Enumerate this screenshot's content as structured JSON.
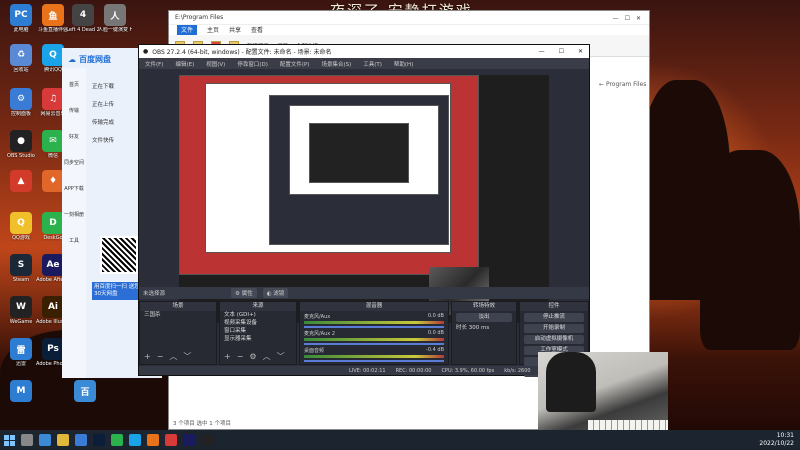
{
  "wallpaper": {
    "title": "夜深了 安静打游戏"
  },
  "desktop_icons": [
    {
      "label": "此电脑",
      "color": "#2d7dd2",
      "glyph": "PC"
    },
    {
      "label": "斗鱼直播伴侣",
      "color": "#e8731b",
      "glyph": "鱼"
    },
    {
      "label": "Left 4 Dead 2",
      "color": "#444",
      "glyph": "4"
    },
    {
      "label": "人脸一键演变 Human Fa...",
      "color": "#777",
      "glyph": "人"
    },
    {
      "label": "回收站",
      "color": "#5a8ad6",
      "glyph": "♻"
    },
    {
      "label": "腾讯QQ",
      "color": "#1aa3e8",
      "glyph": "Q"
    },
    {
      "label": "控制面板",
      "color": "#3a7bd5",
      "glyph": "⚙"
    },
    {
      "label": "网易云音乐",
      "color": "#d83a3a",
      "glyph": "♫"
    },
    {
      "label": "OBS Studio",
      "color": "#222",
      "glyph": "●"
    },
    {
      "label": "微信",
      "color": "#2bb24c",
      "glyph": "✉"
    },
    {
      "label": "",
      "color": "#d23a2a",
      "glyph": "▲"
    },
    {
      "label": "",
      "color": "#e0662a",
      "glyph": "♦"
    },
    {
      "label": "QQ游戏",
      "color": "#f0c02a",
      "glyph": "Q"
    },
    {
      "label": "DeskGo",
      "color": "#2bb24c",
      "glyph": "D"
    },
    {
      "label": "Steam",
      "color": "#1b2838",
      "glyph": "S"
    },
    {
      "label": "Adobe After...",
      "color": "#1a1a5e",
      "glyph": "Ae"
    },
    {
      "label": "WeGame",
      "color": "#222",
      "glyph": "W"
    },
    {
      "label": "Adobe Illustr...",
      "color": "#3a1f00",
      "glyph": "Ai"
    },
    {
      "label": "迅雷",
      "color": "#2d7dd2",
      "glyph": "雷"
    },
    {
      "label": "Adobe Photosh...",
      "color": "#0a1e3a",
      "glyph": "Ps"
    },
    {
      "label": "百度网盘",
      "color": "#3a8ad6",
      "glyph": "云"
    },
    {
      "label": "",
      "color": "#2d7dd2",
      "glyph": "M"
    },
    {
      "label": "",
      "color": "#3a8ad6",
      "glyph": "百"
    }
  ],
  "explorer": {
    "title": "E:\\Program Files",
    "tabs": [
      "文件",
      "主页",
      "共享",
      "查看"
    ],
    "ribbon": [
      "新建项目",
      "打开",
      "全部选择"
    ],
    "sidebar_text": "Program Files",
    "status": "3 个项目  选中 1 个项目"
  },
  "baidu": {
    "app_name": "百度网盘",
    "menu": [
      "正在下载",
      "正在上传",
      "传输完成",
      "文件快传"
    ],
    "nav": [
      "首页",
      "传输",
      "好友",
      "同步空间",
      "APP下载",
      "一刻相册",
      "工具"
    ],
    "qr_text": "用百度扫一扫 送您30天网盘"
  },
  "obs": {
    "title": "OBS 27.2.4 (64-bit, windows) - 配置文件: 未命名 - 场景: 未命名",
    "menu": [
      "文件(F)",
      "编辑(E)",
      "视图(V)",
      "停靠窗口(D)",
      "配置文件(P)",
      "场景集合(S)",
      "工具(T)",
      "帮助(H)"
    ],
    "toolbar": {
      "no_source": "未选择源",
      "props": "属性",
      "filters": "滤镜"
    },
    "docks": {
      "scenes": {
        "title": "场景",
        "items": [
          "三国杀"
        ]
      },
      "sources": {
        "title": "来源",
        "items": [
          "文本 (GDI+)",
          "视频采集设备",
          "窗口采集",
          "显示器采集"
        ]
      },
      "mixer": {
        "title": "混音器",
        "channels": [
          {
            "name": "麦克风/Aux",
            "db": "0.0 dB"
          },
          {
            "name": "麦克风/Aux 2",
            "db": "0.0 dB"
          },
          {
            "name": "桌面音频",
            "db": "-0.4 dB"
          }
        ]
      },
      "transitions": {
        "title": "转场特效",
        "type": "淡出",
        "duration_label": "时长",
        "duration": "300 ms"
      },
      "controls": {
        "title": "控件",
        "buttons": [
          "停止推流",
          "开始录制",
          "启动虚拟摄像机",
          "工作室模式",
          "设置",
          "退出"
        ]
      }
    },
    "status": [
      "LIVE: 00:02:11",
      "REC: 00:00:00",
      "CPU: 3.9%, 60.00 fps",
      "kb/s: 2600"
    ]
  },
  "taskbar": {
    "time": "10:31",
    "date": "2022/10/22"
  }
}
